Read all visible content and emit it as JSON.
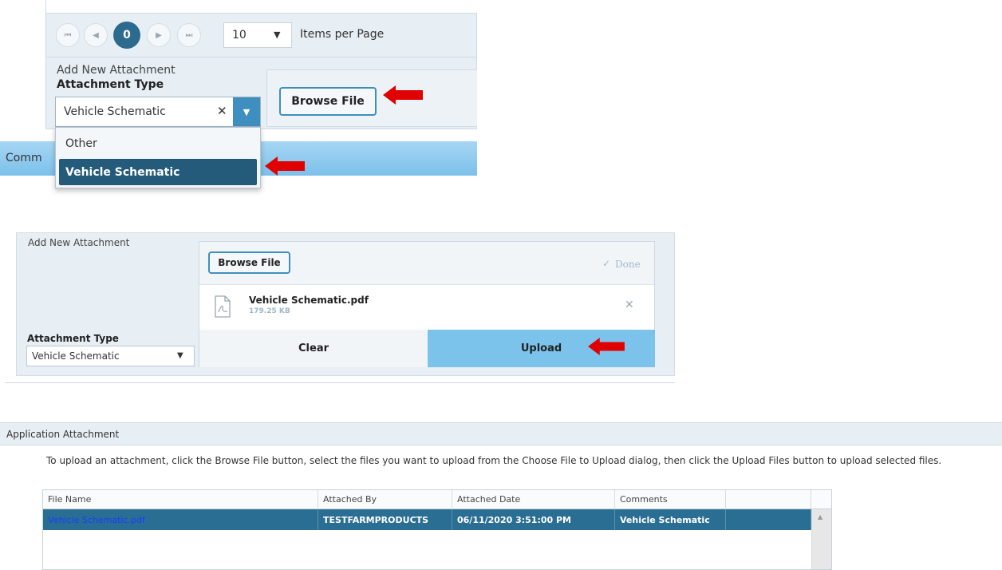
{
  "panel1": {
    "pager": {
      "current_page": "0",
      "page_size": "10",
      "items_per_page_label": "Items per Page"
    },
    "add_new_attachment_label": "Add New Attachment",
    "attachment_type_label": "Attachment Type",
    "selected_type": "Vehicle Schematic",
    "browse_button": "Browse File",
    "comments_bar_partial": "Comm",
    "dropdown_options": [
      "Other",
      "Vehicle Schematic"
    ]
  },
  "panel2": {
    "add_new_attachment_label": "Add New Attachment",
    "browse_button": "Browse File",
    "done_label": "Done",
    "file": {
      "name": "Vehicle Schematic.pdf",
      "size": "179.25 KB"
    },
    "attachment_type_label": "Attachment Type",
    "selected_type": "Vehicle Schematic",
    "clear_button": "Clear",
    "upload_button": "Upload"
  },
  "panel3": {
    "section_title": "Application Attachment",
    "instructions": "To upload an attachment, click the Browse File button, select the files you want to upload from the Choose File to Upload dialog, then click the Upload Files button to upload selected files.",
    "columns": [
      "File Name",
      "Attached By",
      "Attached Date",
      "Comments",
      ""
    ],
    "rows": [
      {
        "file_name": "Vehicle Schematic.pdf",
        "attached_by": "TESTFARMPRODUCTS",
        "attached_date": "06/11/2020 3:51:00 PM",
        "comments": "Vehicle Schematic"
      }
    ]
  },
  "colors": {
    "accent": "#3f8ec0",
    "selected_row": "#2a6f93",
    "upload": "#7cc3ec",
    "arrow": "#e00000",
    "link": "#1a3cff"
  }
}
